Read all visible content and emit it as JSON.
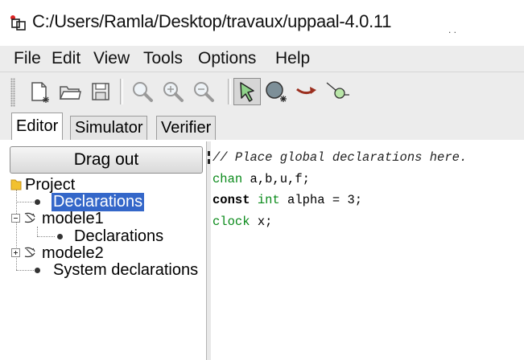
{
  "window": {
    "title": "C:/Users/Ramla/Desktop/travaux/uppaal-4.0.11"
  },
  "menubar": {
    "items": [
      "File",
      "Edit",
      "View",
      "Tools",
      "Options",
      "Help"
    ]
  },
  "toolbar": {
    "buttons": [
      {
        "icon": "new-document-icon"
      },
      {
        "icon": "open-folder-icon"
      },
      {
        "icon": "save-disk-icon"
      },
      {
        "icon": "zoom-icon"
      },
      {
        "icon": "zoom-in-icon"
      },
      {
        "icon": "zoom-out-icon"
      },
      {
        "icon": "select-arrow-icon",
        "active": true
      },
      {
        "icon": "add-location-icon"
      },
      {
        "icon": "add-edge-icon"
      },
      {
        "icon": "add-nail-icon"
      }
    ]
  },
  "tabs": [
    {
      "label": "Editor",
      "active": true
    },
    {
      "label": "Simulator",
      "active": false
    },
    {
      "label": "Verifier",
      "active": false
    }
  ],
  "sidebar": {
    "drag_button": "Drag out",
    "tree": {
      "project": "Project",
      "declarations": "Declarations",
      "template1": "modele1",
      "template1_declarations": "Declarations",
      "template2": "modele2",
      "system": "System declarations"
    }
  },
  "editor": {
    "comment": "// Place global declarations here.",
    "line2_kw": "chan",
    "line2_rest": " a,b,u,f;",
    "line3_kw1": "const",
    "line3_kw2": "int",
    "line3_rest": " alpha = 3;",
    "line4_kw": "clock",
    "line4_rest": " x;"
  },
  "colors": {
    "selection": "#3467c9",
    "keyword_green": "#0a8a1a",
    "folder_yellow": "#f2c12e"
  }
}
